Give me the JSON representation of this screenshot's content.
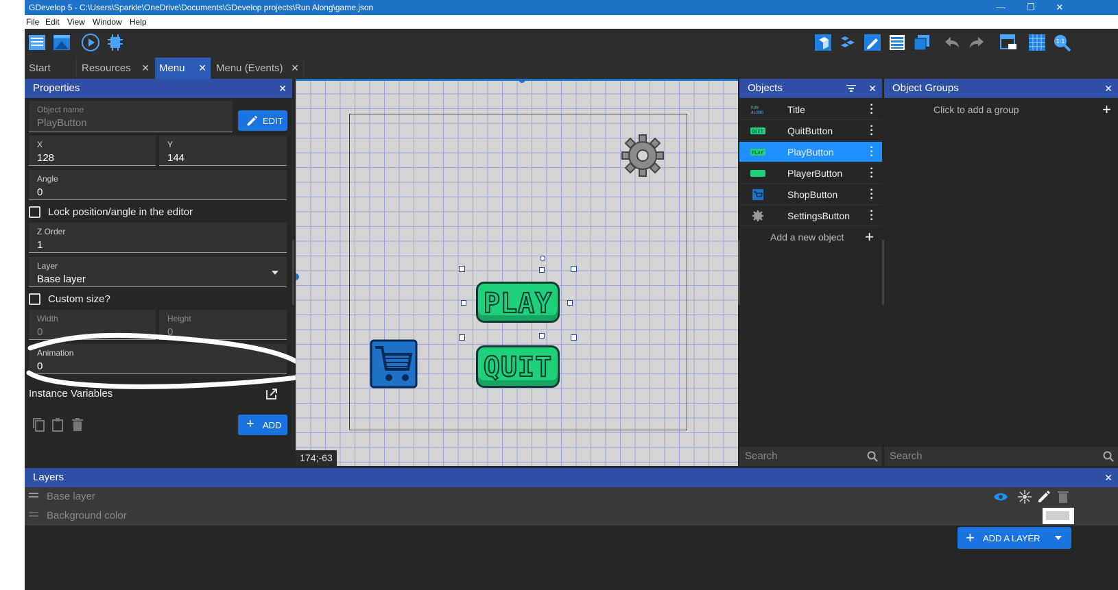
{
  "titlebar": {
    "title": "GDevelop 5 - C:\\Users\\Sparkle\\OneDrive\\Documents\\GDevelop projects\\Run Along\\game.json",
    "minimize": "—",
    "maximize": "❐",
    "close": "✕"
  },
  "menubar": {
    "items": [
      "File",
      "Edit",
      "View",
      "Window",
      "Help"
    ]
  },
  "tabs": [
    {
      "label": "Start Page",
      "closable": false
    },
    {
      "label": "Resources",
      "closable": true
    },
    {
      "label": "Menu",
      "closable": true,
      "active": true
    },
    {
      "label": "Menu (Events)",
      "closable": true
    }
  ],
  "properties": {
    "header": "Properties",
    "object_name_label": "Object name",
    "object_name_value": "PlayButton",
    "edit_label": "EDIT",
    "x_label": "X",
    "x_value": "128",
    "y_label": "Y",
    "y_value": "144",
    "angle_label": "Angle",
    "angle_value": "0",
    "lock_label": "Lock position/angle in the editor",
    "zorder_label": "Z Order",
    "zorder_value": "1",
    "layer_label": "Layer",
    "layer_value": "Base layer",
    "custom_size_label": "Custom size?",
    "width_label": "Width",
    "width_value": "0",
    "height_label": "Height",
    "height_value": "0",
    "animation_label": "Animation",
    "animation_value": "0",
    "instance_vars_label": "Instance Variables",
    "add_label": "ADD"
  },
  "scene": {
    "coords": "174;-63",
    "play_text": "PLAY",
    "quit_text": "QUIT"
  },
  "objects": {
    "header": "Objects",
    "items": [
      "Title",
      "QuitButton",
      "PlayButton",
      "PlayerButton",
      "ShopButton",
      "SettingsButton"
    ],
    "selected": "PlayButton",
    "add_label": "Add a new object",
    "search_placeholder": "Search"
  },
  "groups": {
    "header": "Object Groups",
    "add_label": "Click to add a group",
    "search_placeholder": "Search"
  },
  "layers": {
    "header": "Layers",
    "rows": [
      "Base layer",
      "Background color"
    ],
    "add_label": "ADD A LAYER"
  },
  "colors": {
    "accent": "#1a74e0",
    "header": "#3050a8",
    "selected": "#1e90ff",
    "button_green": "#1fd07a"
  },
  "icons": [
    "gdevelop-logo-icon",
    "project-manager-icon",
    "scene-icon",
    "preview-play-icon",
    "debug-icon",
    "objects-panel-icon",
    "groups-panel-icon",
    "properties-panel-icon",
    "instances-list-icon",
    "layers-panel-icon",
    "undo-icon",
    "redo-icon",
    "window-mask-icon",
    "grid-icon",
    "zoom-icon"
  ]
}
